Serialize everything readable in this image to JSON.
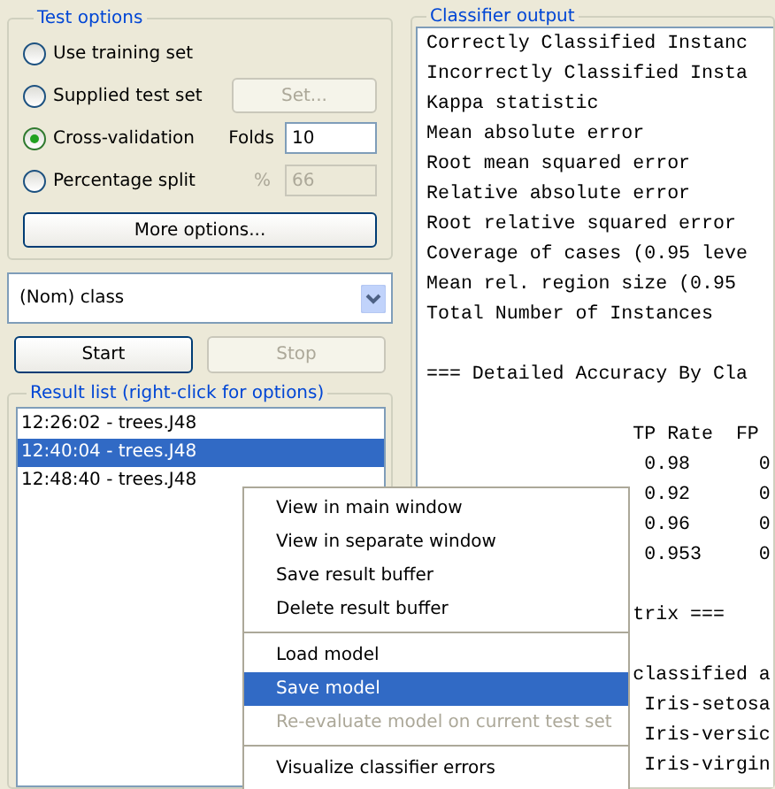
{
  "test_options": {
    "title": "Test options",
    "options": [
      {
        "label": "Use training set",
        "selected": false
      },
      {
        "label": "Supplied test set",
        "selected": false
      },
      {
        "label": "Cross-validation",
        "selected": true
      },
      {
        "label": "Percentage split",
        "selected": false
      }
    ],
    "set_button": {
      "label": "Set...",
      "disabled": true
    },
    "folds": {
      "label": "Folds",
      "value": "10",
      "disabled": false
    },
    "percent": {
      "label": "%",
      "value": "66",
      "disabled": true
    },
    "more_button": "More options..."
  },
  "class_select": {
    "value": "(Nom) class"
  },
  "start_button": {
    "label": "Start",
    "disabled": false
  },
  "stop_button": {
    "label": "Stop",
    "disabled": true
  },
  "result_list": {
    "title": "Result list (right-click for options)",
    "items": [
      {
        "label": "12:26:02 - trees.J48",
        "selected": false
      },
      {
        "label": "12:40:04 - trees.J48",
        "selected": true
      },
      {
        "label": "12:48:40 - trees.J48",
        "selected": false
      }
    ]
  },
  "classifier_output": {
    "title": "Classifier output",
    "sections": [
      [
        "Correctly Classified Instanc",
        "Incorrectly Classified Insta",
        "Kappa statistic",
        "Mean absolute error",
        "Root mean squared error",
        "Relative absolute error",
        "Root relative squared error",
        "Coverage of cases (0.95 leve",
        "Mean rel. region size (0.95",
        "Total Number of Instances"
      ],
      [
        "=== Detailed Accuracy By Cla"
      ],
      [
        "                  TP Rate  FP",
        "                   0.98      0",
        "                   0.92      0",
        "                   0.96      0",
        "                   0.953     0"
      ],
      [
        "                  trix ==="
      ],
      [
        "                  classified a",
        "                   Iris-setosa",
        "                   Iris-versic",
        "                   Iris-virgin"
      ]
    ]
  },
  "context_menu": {
    "groups": [
      [
        {
          "label": "View in main window",
          "selected": false,
          "disabled": false
        },
        {
          "label": "View in separate window",
          "selected": false,
          "disabled": false
        },
        {
          "label": "Save result buffer",
          "selected": false,
          "disabled": false
        },
        {
          "label": "Delete result buffer",
          "selected": false,
          "disabled": false
        }
      ],
      [
        {
          "label": "Load model",
          "selected": false,
          "disabled": false
        },
        {
          "label": "Save model",
          "selected": true,
          "disabled": false
        },
        {
          "label": "Re-evaluate model on current test set",
          "selected": false,
          "disabled": true
        }
      ],
      [
        {
          "label": "Visualize classifier errors",
          "selected": false,
          "disabled": false
        }
      ]
    ]
  }
}
